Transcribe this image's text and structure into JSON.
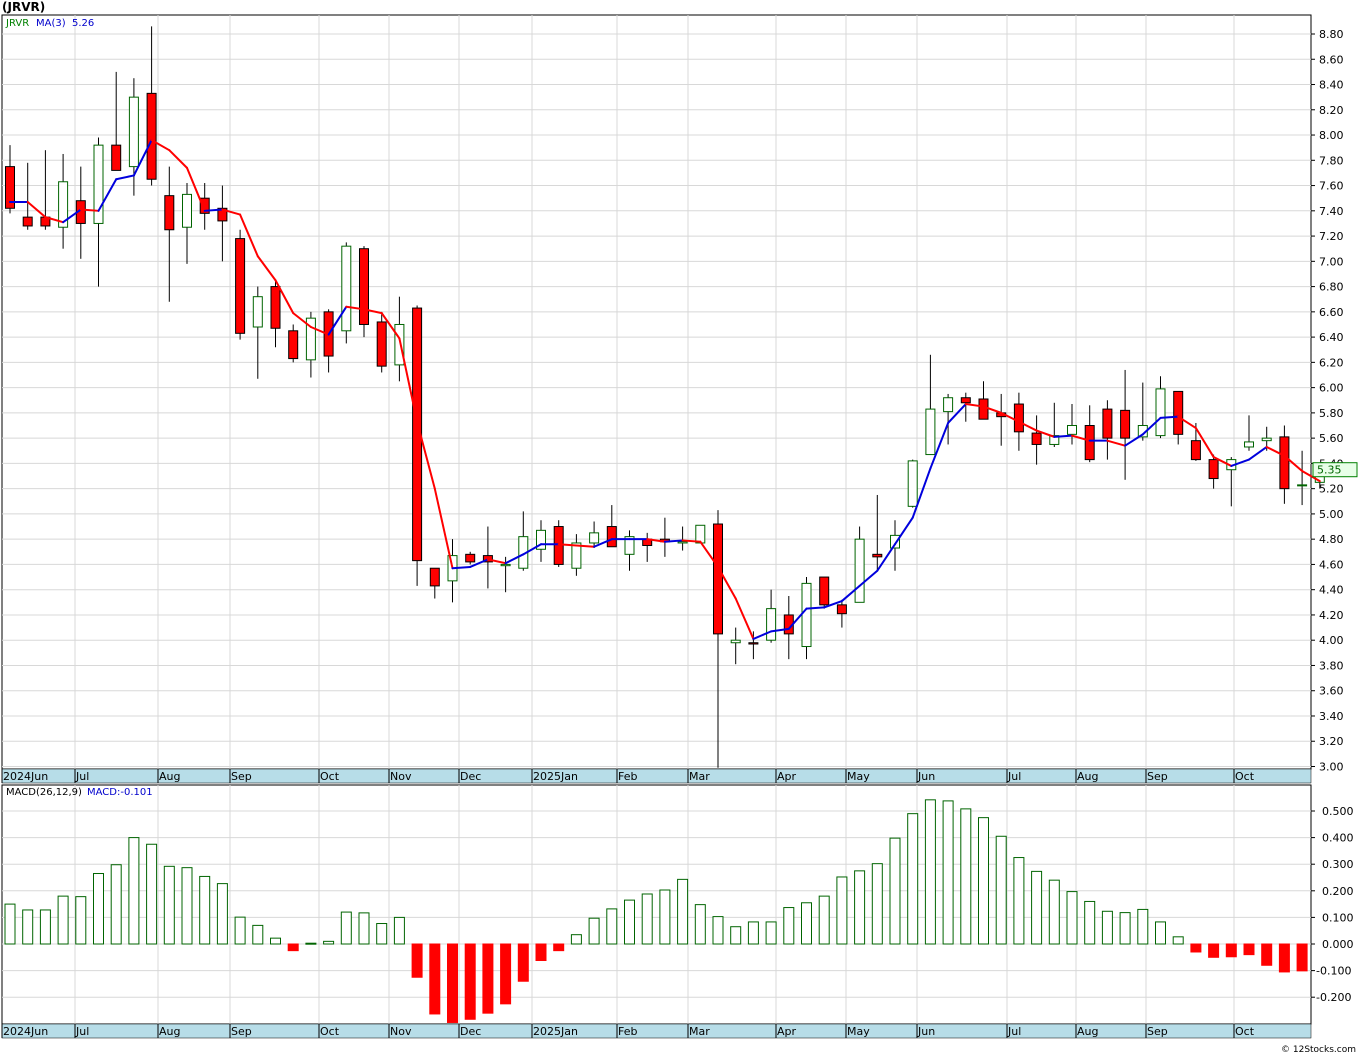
{
  "title": "(JRVR)",
  "footer": "© 12Stocks.com",
  "price_panel": {
    "symbol_label": "JRVR",
    "ma_label": "MA(3)",
    "ma_value_label": "5.26",
    "last_price_label": "5.35",
    "y_ticks": [
      "8.80",
      "8.60",
      "8.40",
      "8.20",
      "8.00",
      "7.80",
      "7.60",
      "7.40",
      "7.20",
      "7.00",
      "6.80",
      "6.60",
      "6.40",
      "6.20",
      "6.00",
      "5.80",
      "5.60",
      "5.40",
      "5.20",
      "5.00",
      "4.80",
      "4.60",
      "4.40",
      "4.20",
      "4.00",
      "3.80",
      "3.60",
      "3.40",
      "3.20",
      "3.00"
    ]
  },
  "macd_panel": {
    "params_label": "MACD(26,12,9)",
    "value_label": "MACD:-0.101",
    "y_ticks": [
      "0.500",
      "0.400",
      "0.300",
      "0.200",
      "0.100",
      "0.000",
      "-0.100",
      "-0.200"
    ]
  },
  "x_labels": [
    "2024Jun",
    "Jul",
    "Aug",
    "Sep",
    "Oct",
    "Nov",
    "Dec",
    "2025Jan",
    "Feb",
    "Mar",
    "Apr",
    "May",
    "Jun",
    "Jul",
    "Aug",
    "Sep",
    "Oct"
  ],
  "colors": {
    "up_candle": "#ffffff",
    "up_outline": "#006400",
    "down_candle": "#ff0000",
    "ma_up": "#0000dd",
    "ma_down": "#ff0000",
    "macd_pos": "#ffffff",
    "macd_pos_outline": "#006400",
    "macd_neg": "#ff0000",
    "axis_bar": "#b7dde8",
    "grid": "#d8d8d8"
  },
  "chart_data": {
    "type": "candlestick",
    "interval": "weekly",
    "ylim": [
      3.0,
      8.9
    ],
    "candles": [
      {
        "o": 7.75,
        "h": 7.92,
        "l": 7.38,
        "c": 7.42
      },
      {
        "o": 7.35,
        "h": 7.78,
        "l": 7.25,
        "c": 7.28
      },
      {
        "o": 7.35,
        "h": 7.88,
        "l": 7.25,
        "c": 7.28
      },
      {
        "o": 7.27,
        "h": 7.85,
        "l": 7.1,
        "c": 7.63
      },
      {
        "o": 7.48,
        "h": 7.75,
        "l": 7.02,
        "c": 7.3
      },
      {
        "o": 7.3,
        "h": 7.98,
        "l": 6.8,
        "c": 7.92
      },
      {
        "o": 7.92,
        "h": 8.5,
        "l": 7.8,
        "c": 7.72
      },
      {
        "o": 7.75,
        "h": 8.45,
        "l": 7.52,
        "c": 8.3
      },
      {
        "o": 8.33,
        "h": 8.86,
        "l": 7.6,
        "c": 7.65
      },
      {
        "o": 7.52,
        "h": 7.75,
        "l": 6.68,
        "c": 7.25
      },
      {
        "o": 7.27,
        "h": 7.62,
        "l": 6.98,
        "c": 7.53
      },
      {
        "o": 7.5,
        "h": 7.62,
        "l": 7.25,
        "c": 7.38
      },
      {
        "o": 7.42,
        "h": 7.6,
        "l": 7.0,
        "c": 7.32
      },
      {
        "o": 7.18,
        "h": 7.25,
        "l": 6.38,
        "c": 6.43
      },
      {
        "o": 6.48,
        "h": 6.8,
        "l": 6.07,
        "c": 6.72
      },
      {
        "o": 6.8,
        "h": 6.85,
        "l": 6.32,
        "c": 6.47
      },
      {
        "o": 6.45,
        "h": 6.5,
        "l": 6.2,
        "c": 6.23
      },
      {
        "o": 6.22,
        "h": 6.6,
        "l": 6.08,
        "c": 6.55
      },
      {
        "o": 6.6,
        "h": 6.62,
        "l": 6.12,
        "c": 6.25
      },
      {
        "o": 6.45,
        "h": 7.15,
        "l": 6.35,
        "c": 7.12
      },
      {
        "o": 7.1,
        "h": 7.12,
        "l": 6.4,
        "c": 6.5
      },
      {
        "o": 6.52,
        "h": 6.6,
        "l": 6.12,
        "c": 6.17
      },
      {
        "o": 6.18,
        "h": 6.72,
        "l": 6.05,
        "c": 6.5
      },
      {
        "o": 6.63,
        "h": 6.65,
        "l": 4.43,
        "c": 4.63
      },
      {
        "o": 4.57,
        "h": 4.57,
        "l": 4.33,
        "c": 4.43
      },
      {
        "o": 4.47,
        "h": 4.8,
        "l": 4.3,
        "c": 4.67
      },
      {
        "o": 4.68,
        "h": 4.7,
        "l": 4.6,
        "c": 4.62
      },
      {
        "o": 4.67,
        "h": 4.9,
        "l": 4.41,
        "c": 4.62
      },
      {
        "o": 4.59,
        "h": 4.66,
        "l": 4.38,
        "c": 4.6
      },
      {
        "o": 4.57,
        "h": 5.02,
        "l": 4.55,
        "c": 4.82
      },
      {
        "o": 4.72,
        "h": 4.95,
        "l": 4.62,
        "c": 4.87
      },
      {
        "o": 4.9,
        "h": 4.95,
        "l": 4.58,
        "c": 4.6
      },
      {
        "o": 4.57,
        "h": 4.84,
        "l": 4.51,
        "c": 4.77
      },
      {
        "o": 4.77,
        "h": 4.94,
        "l": 4.73,
        "c": 4.85
      },
      {
        "o": 4.9,
        "h": 5.07,
        "l": 4.74,
        "c": 4.74
      },
      {
        "o": 4.68,
        "h": 4.87,
        "l": 4.55,
        "c": 4.82
      },
      {
        "o": 4.8,
        "h": 4.85,
        "l": 4.62,
        "c": 4.75
      },
      {
        "o": 4.8,
        "h": 4.97,
        "l": 4.66,
        "c": 4.78
      },
      {
        "o": 4.77,
        "h": 4.9,
        "l": 4.71,
        "c": 4.78
      },
      {
        "o": 4.77,
        "h": 4.91,
        "l": 4.77,
        "c": 4.91
      },
      {
        "o": 4.92,
        "h": 5.03,
        "l": 2.99,
        "c": 4.05
      },
      {
        "o": 3.98,
        "h": 4.1,
        "l": 3.81,
        "c": 4.0
      },
      {
        "o": 3.98,
        "h": 4.07,
        "l": 3.85,
        "c": 3.97
      },
      {
        "o": 4.0,
        "h": 4.4,
        "l": 3.98,
        "c": 4.25
      },
      {
        "o": 4.2,
        "h": 4.35,
        "l": 3.85,
        "c": 4.05
      },
      {
        "o": 3.95,
        "h": 4.5,
        "l": 3.85,
        "c": 4.45
      },
      {
        "o": 4.5,
        "h": 4.5,
        "l": 4.25,
        "c": 4.28
      },
      {
        "o": 4.28,
        "h": 4.32,
        "l": 4.1,
        "c": 4.21
      },
      {
        "o": 4.3,
        "h": 4.9,
        "l": 4.3,
        "c": 4.8
      },
      {
        "o": 4.68,
        "h": 5.15,
        "l": 4.55,
        "c": 4.66
      },
      {
        "o": 4.73,
        "h": 4.95,
        "l": 4.55,
        "c": 4.83
      },
      {
        "o": 5.06,
        "h": 5.43,
        "l": 5.05,
        "c": 5.42
      },
      {
        "o": 5.47,
        "h": 6.26,
        "l": 5.47,
        "c": 5.83
      },
      {
        "o": 5.81,
        "h": 5.95,
        "l": 5.55,
        "c": 5.92
      },
      {
        "o": 5.92,
        "h": 5.96,
        "l": 5.73,
        "c": 5.88
      },
      {
        "o": 5.91,
        "h": 6.05,
        "l": 5.75,
        "c": 5.75
      },
      {
        "o": 5.8,
        "h": 5.95,
        "l": 5.54,
        "c": 5.77
      },
      {
        "o": 5.87,
        "h": 5.96,
        "l": 5.5,
        "c": 5.65
      },
      {
        "o": 5.64,
        "h": 5.78,
        "l": 5.39,
        "c": 5.55
      },
      {
        "o": 5.55,
        "h": 5.88,
        "l": 5.53,
        "c": 5.62
      },
      {
        "o": 5.63,
        "h": 5.87,
        "l": 5.55,
        "c": 5.7
      },
      {
        "o": 5.7,
        "h": 5.86,
        "l": 5.41,
        "c": 5.43
      },
      {
        "o": 5.83,
        "h": 5.9,
        "l": 5.43,
        "c": 5.6
      },
      {
        "o": 5.82,
        "h": 6.14,
        "l": 5.27,
        "c": 5.6
      },
      {
        "o": 5.61,
        "h": 6.04,
        "l": 5.58,
        "c": 5.7
      },
      {
        "o": 5.62,
        "h": 6.09,
        "l": 5.6,
        "c": 5.99
      },
      {
        "o": 5.97,
        "h": 5.97,
        "l": 5.55,
        "c": 5.63
      },
      {
        "o": 5.58,
        "h": 5.72,
        "l": 5.42,
        "c": 5.43
      },
      {
        "o": 5.43,
        "h": 5.47,
        "l": 5.2,
        "c": 5.28
      },
      {
        "o": 5.35,
        "h": 5.45,
        "l": 5.06,
        "c": 5.43
      },
      {
        "o": 5.53,
        "h": 5.78,
        "l": 5.5,
        "c": 5.57
      },
      {
        "o": 5.58,
        "h": 5.69,
        "l": 5.5,
        "c": 5.6
      },
      {
        "o": 5.61,
        "h": 5.7,
        "l": 5.08,
        "c": 5.2
      },
      {
        "o": 5.23,
        "h": 5.5,
        "l": 5.07,
        "c": 5.23
      },
      {
        "o": 5.25,
        "h": 5.37,
        "l": 5.2,
        "c": 5.35
      }
    ],
    "ma3": [
      7.47,
      7.47,
      7.35,
      7.31,
      7.41,
      7.4,
      7.65,
      7.68,
      7.96,
      7.88,
      7.74,
      7.4,
      7.41,
      7.37,
      7.04,
      6.85,
      6.59,
      6.48,
      6.42,
      6.64,
      6.62,
      6.59,
      6.39,
      5.73,
      5.2,
      4.57,
      4.58,
      4.64,
      4.61,
      4.68,
      4.76,
      4.76,
      4.75,
      4.74,
      4.8,
      4.8,
      4.8,
      4.78,
      4.79,
      4.78,
      4.58,
      4.33,
      4.01,
      4.07,
      4.09,
      4.25,
      4.26,
      4.31,
      4.43,
      4.55,
      4.76,
      4.97,
      5.36,
      5.72,
      5.87,
      5.85,
      5.8,
      5.73,
      5.66,
      5.61,
      5.62,
      5.58,
      5.58,
      5.54,
      5.63,
      5.76,
      5.77,
      5.68,
      5.45,
      5.38,
      5.43,
      5.53,
      5.46,
      5.34,
      5.26
    ],
    "macd_hist": [
      0.15,
      0.128,
      0.128,
      0.18,
      0.178,
      0.265,
      0.298,
      0.4,
      0.375,
      0.292,
      0.287,
      0.254,
      0.227,
      0.101,
      0.07,
      0.022,
      -0.025,
      0.003,
      0.01,
      0.12,
      0.117,
      0.077,
      0.1,
      -0.125,
      -0.263,
      -0.295,
      -0.283,
      -0.26,
      -0.225,
      -0.14,
      -0.062,
      -0.025,
      0.035,
      0.097,
      0.132,
      0.165,
      0.188,
      0.203,
      0.243,
      0.148,
      0.103,
      0.065,
      0.083,
      0.083,
      0.137,
      0.155,
      0.18,
      0.252,
      0.275,
      0.302,
      0.398,
      0.49,
      0.542,
      0.538,
      0.508,
      0.475,
      0.405,
      0.325,
      0.273,
      0.24,
      0.197,
      0.16,
      0.123,
      0.118,
      0.13,
      0.083,
      0.027,
      -0.03,
      -0.05,
      -0.048,
      -0.04,
      -0.08,
      -0.105,
      -0.101
    ]
  }
}
